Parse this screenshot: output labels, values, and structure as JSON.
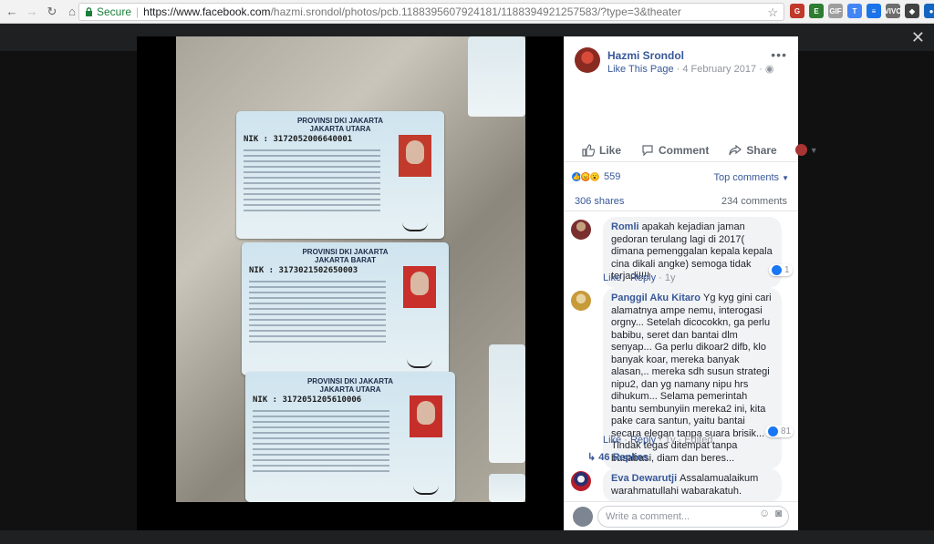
{
  "browser": {
    "secure_label": "Secure",
    "url_host": "https://www.facebook.com",
    "url_path": "/hazmi.srondol/photos/pcb.1188395607924181/1188394921257583/?type=3&theater",
    "extensions": [
      {
        "name": "ext-red",
        "color": "#c0392b",
        "label": "G"
      },
      {
        "name": "ext-green",
        "color": "#2e7d32",
        "label": "E"
      },
      {
        "name": "ext-gif",
        "color": "#9e9e9e",
        "label": "GIF"
      },
      {
        "name": "ext-translate",
        "color": "#4285f4",
        "label": "T"
      },
      {
        "name": "ext-blue",
        "color": "#1a73e8",
        "label": "≡"
      },
      {
        "name": "ext-vivo",
        "color": "#6d6d6d",
        "label": "VIVO"
      },
      {
        "name": "ext-shield",
        "color": "#424242",
        "label": "◆"
      },
      {
        "name": "ext-circle",
        "color": "#1565c0",
        "label": "●"
      }
    ]
  },
  "post": {
    "author": "Hazmi Srondol",
    "like_page": "Like This Page",
    "date": "4 February 2017",
    "actions": {
      "like": "Like",
      "comment": "Comment",
      "share": "Share"
    },
    "reaction_count": "559",
    "top_comments": "Top comments",
    "shares": "306 shares",
    "comments_count": "234 comments"
  },
  "photo": {
    "cards": [
      {
        "title1": "PROVINSI DKI JAKARTA",
        "title2": "JAKARTA UTARA",
        "nik": "NIK   : 3172052006640001"
      },
      {
        "title1": "PROVINSI DKI JAKARTA",
        "title2": "JAKARTA BARAT",
        "nik": "NIK   : 3173021502650003"
      },
      {
        "title1": "PROVINSI DKI JAKARTA",
        "title2": "JAKARTA UTARA",
        "nik": "NIK   : 3172051205610006"
      }
    ]
  },
  "comments": [
    {
      "author": "Romli",
      "text": "apakah kejadian jaman gedoran terulang lagi di 2017( dimana pemenggalan kepala kepala cina dikali angke) semoga tidak terjadi!!!!",
      "like": "Like",
      "reply": "Reply",
      "age": "1y",
      "likes": "1"
    },
    {
      "author": "Panggil Aku Kitaro",
      "text": "Yg kyg gini cari alamatnya ampe nemu, interogasi orgny... Setelah dicocokkn, ga perlu babibu, seret dan bantai dlm senyap... Ga perlu dikoar2 difb, klo banyak koar, mereka banyak alasan,.. mereka sdh susun strategi nipu2, dan yg namany nipu hrs dihukum... Selama pemerintah bantu sembunyiin mereka2 ini, kita pake cara santun, yaitu bantai secara elegan tanpa suara brisik... Tindak tegas ditempat tanpa basabasi, diam dan beres...",
      "like": "Like",
      "reply": "Reply",
      "age": "1y",
      "edited": "Edited",
      "likes": "81",
      "replies": "46 Replies"
    },
    {
      "author": "Eva Dewarutji",
      "text": "Assalamualaikum warahmatullahi wabarakatuh."
    }
  ],
  "write": {
    "placeholder": "Write a comment..."
  }
}
